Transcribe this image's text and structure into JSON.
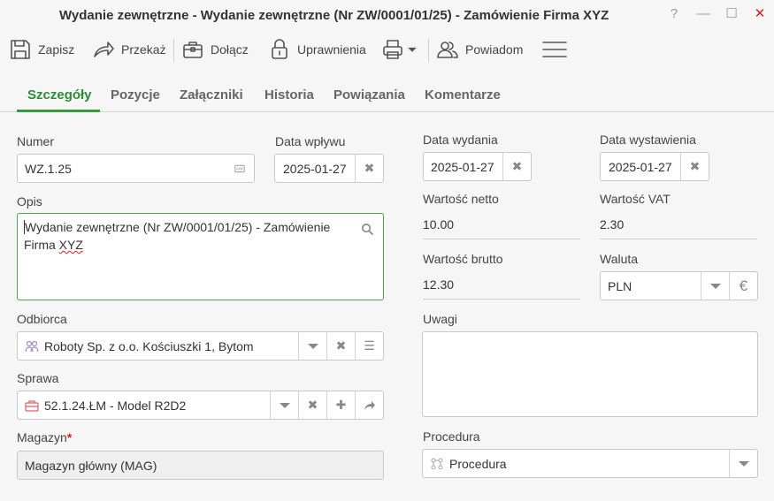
{
  "window": {
    "title": "Wydanie zewnętrzne - Wydanie zewnętrzne (Nr ZW/0001/01/25) - Zamówienie Firma XYZ",
    "help": "?",
    "minimize": "—",
    "maximize": "☐",
    "close": "✕",
    "close_color": "#e02020"
  },
  "toolbar": {
    "save": "Zapisz",
    "forward": "Przekaż",
    "attach": "Dołącz",
    "permissions": "Uprawnienia",
    "notify": "Powiadom"
  },
  "tabs": [
    "Szczegóły",
    "Pozycje",
    "Załączniki",
    "Historia",
    "Powiązania",
    "Komentarze"
  ],
  "accent_color": "#3a9a3f",
  "form": {
    "numer": {
      "label": "Numer",
      "value": "WZ.1.25"
    },
    "data_wplywu": {
      "label": "Data wpływu",
      "value": "2025-01-27"
    },
    "data_wydania": {
      "label": "Data wydania",
      "value": "2025-01-27"
    },
    "data_wystawienia": {
      "label": "Data wystawienia",
      "value": "2025-01-27"
    },
    "opis": {
      "label": "Opis",
      "line1": "Wydanie zewnętrzne (Nr ZW/0001/01/25) - Zamówienie",
      "line2_a": "Firma ",
      "line2_b": "XYZ"
    },
    "wartosc_netto": {
      "label": "Wartość netto",
      "value": "10.00"
    },
    "wartosc_vat": {
      "label": "Wartość VAT",
      "value": "2.30"
    },
    "wartosc_brutto": {
      "label": "Wartość brutto",
      "value": "12.30"
    },
    "waluta": {
      "label": "Waluta",
      "value": "PLN",
      "currency_symbol": "€"
    },
    "odbiorca": {
      "label": "Odbiorca",
      "value": "Roboty Sp. z o.o. Kościuszki 1, Bytom"
    },
    "uwagi": {
      "label": "Uwagi",
      "value": ""
    },
    "sprawa": {
      "label": "Sprawa",
      "value": "52.1.24.ŁM - Model R2D2"
    },
    "magazyn": {
      "label": "Magazyn",
      "required_mark": "*",
      "value": "Magazyn główny (MAG)"
    },
    "procedura": {
      "label": "Procedura",
      "placeholder": "Procedura"
    }
  },
  "icons": {
    "clear": "✖",
    "plus": "✚",
    "menu": "☰"
  }
}
